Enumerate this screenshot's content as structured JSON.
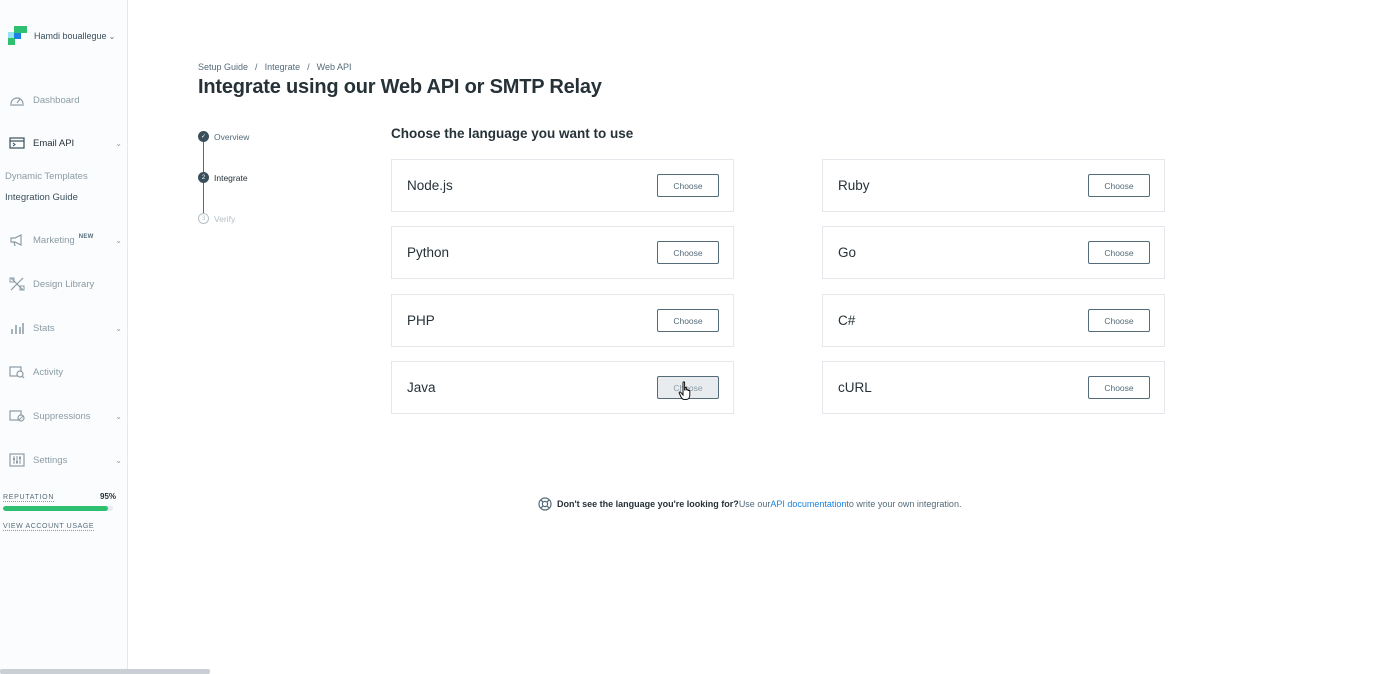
{
  "sidebar": {
    "account_name": "Hamdi bouallegue",
    "nav": [
      {
        "label": "Dashboard",
        "icon": "dashboard-icon"
      },
      {
        "label": "Email API",
        "icon": "email-api-icon"
      },
      {
        "label": "Marketing",
        "icon": "megaphone-icon",
        "badge": "NEW"
      },
      {
        "label": "Design Library",
        "icon": "design-tools-icon"
      },
      {
        "label": "Stats",
        "icon": "stats-icon"
      },
      {
        "label": "Activity",
        "icon": "activity-icon"
      },
      {
        "label": "Suppressions",
        "icon": "suppressions-icon"
      },
      {
        "label": "Settings",
        "icon": "settings-icon"
      }
    ],
    "sub_items": [
      "Dynamic Templates",
      "Integration Guide"
    ],
    "reputation": {
      "label": "REPUTATION",
      "value": "95%",
      "percent": 95
    },
    "usage_link": "VIEW ACCOUNT USAGE"
  },
  "breadcrumb": [
    "Setup Guide",
    "Integrate",
    "Web API"
  ],
  "page_title": "Integrate using our Web API or SMTP Relay",
  "steps": [
    {
      "label": "Overview",
      "state": "done",
      "marker": "✓"
    },
    {
      "label": "Integrate",
      "state": "current",
      "marker": "2"
    },
    {
      "label": "Verify",
      "state": "pending",
      "marker": "3"
    }
  ],
  "section_title": "Choose the language you want to use",
  "languages": [
    "Node.js",
    "Ruby",
    "Python",
    "Go",
    "PHP",
    "C#",
    "Java",
    "cURL"
  ],
  "choose_label": "Choose",
  "help": {
    "bold": "Don't see the language you're looking for?",
    "pre": " Use our ",
    "link": "API documentation",
    "post": " to write your own integration."
  },
  "colors": {
    "accent": "#1a82e2",
    "success": "#2fbf71",
    "text": "#263238",
    "muted": "#546b79"
  }
}
